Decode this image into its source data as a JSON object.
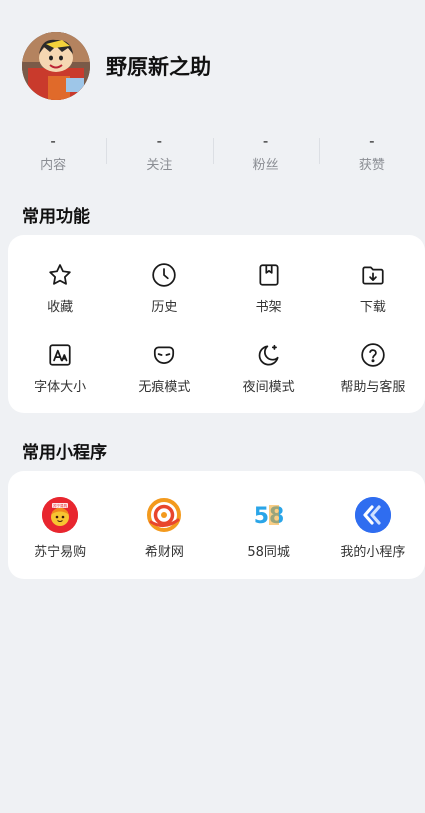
{
  "profile": {
    "name": "野原新之助"
  },
  "stats": [
    {
      "value": "-",
      "label": "内容"
    },
    {
      "value": "-",
      "label": "关注"
    },
    {
      "value": "-",
      "label": "粉丝"
    },
    {
      "value": "-",
      "label": "获赞"
    }
  ],
  "functions": {
    "title": "常用功能",
    "items": [
      {
        "label": "收藏",
        "icon": "star-icon"
      },
      {
        "label": "历史",
        "icon": "clock-icon"
      },
      {
        "label": "书架",
        "icon": "bookshelf-icon"
      },
      {
        "label": "下载",
        "icon": "download-folder-icon"
      },
      {
        "label": "字体大小",
        "icon": "font-size-icon"
      },
      {
        "label": "无痕模式",
        "icon": "incognito-mask-icon"
      },
      {
        "label": "夜间模式",
        "icon": "moon-icon"
      },
      {
        "label": "帮助与客服",
        "icon": "help-icon"
      }
    ]
  },
  "mini_programs": {
    "title": "常用小程序",
    "items": [
      {
        "label": "苏宁易购",
        "icon": "suning-icon",
        "badge": "苏宁易购"
      },
      {
        "label": "希财网",
        "icon": "xicai-icon"
      },
      {
        "label": "58同城",
        "icon": "58-icon",
        "logo": "58"
      },
      {
        "label": "我的小程序",
        "icon": "my-mini-program-icon"
      }
    ]
  },
  "colors": {
    "background": "#eff1f4",
    "suning_red": "#e8262f",
    "xicai_orange": "#f39a1d",
    "mini_program_blue": "#2f6df0"
  }
}
